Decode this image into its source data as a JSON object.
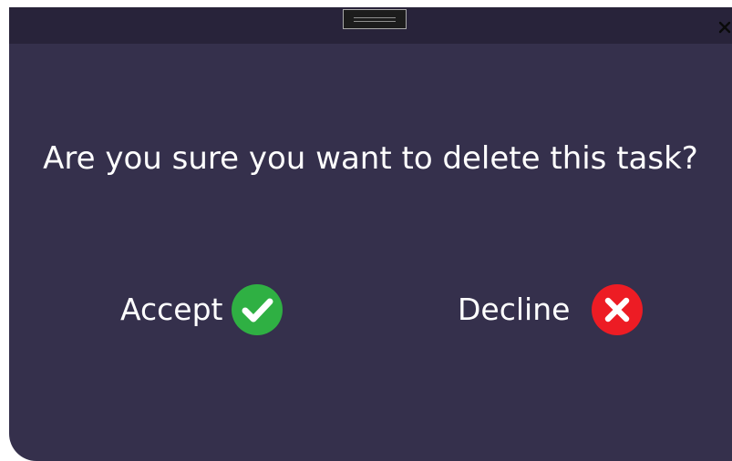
{
  "dialog": {
    "question": "Are you sure you want to delete this task?",
    "accept_label": "Accept",
    "decline_label": "Decline"
  },
  "titlebar": {
    "drag_icon": "drag-handle-icon",
    "close_icon": "close-icon"
  },
  "icons": {
    "accept": "check-circle-icon",
    "decline": "x-circle-icon"
  },
  "colors": {
    "background": "#35304c",
    "titlebar": "#28233a",
    "text": "#ffffff",
    "accept": "#2fb043",
    "decline": "#ed1c24"
  }
}
